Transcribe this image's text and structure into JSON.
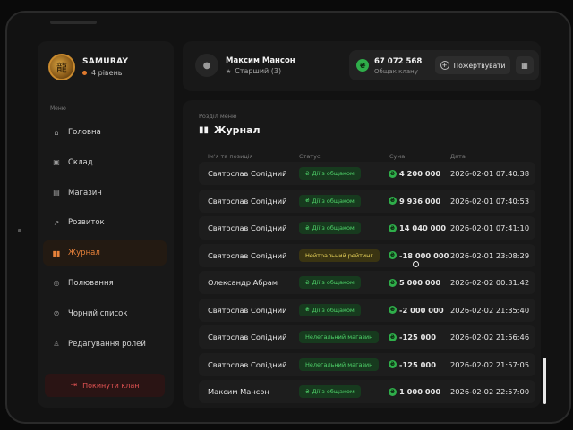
{
  "sidebar": {
    "profile": {
      "name": "SAMURAY",
      "level": "4 рівень",
      "avatar_icon": "dragon-emblem-icon"
    },
    "menu_caption": "Меню",
    "items": [
      {
        "label": "Головна",
        "icon": "home-icon"
      },
      {
        "label": "Склад",
        "icon": "box-icon"
      },
      {
        "label": "Магазин",
        "icon": "store-icon"
      },
      {
        "label": "Розвиток",
        "icon": "chart-icon"
      },
      {
        "label": "Журнал",
        "icon": "book-icon",
        "active": true
      },
      {
        "label": "Полювання",
        "icon": "target-icon"
      },
      {
        "label": "Чорний список",
        "icon": "ban-icon"
      },
      {
        "label": "Редагування ролей",
        "icon": "user-edit-icon"
      }
    ],
    "leave_button": "Покинути клан"
  },
  "header": {
    "user_name": "Максим Мансон",
    "user_rank": "Старший (3)",
    "funds_amount": "67 072 568",
    "funds_caption": "Общак клану",
    "donate_button": "Пожертвувати"
  },
  "journal": {
    "section_caption": "Розділ меню",
    "title": "Журнал",
    "columns": {
      "name": "Ім'я та позиція",
      "status": "Статус",
      "amount": "Сума",
      "date": "Дата"
    },
    "rows": [
      {
        "name": "Святослав Солідний",
        "status": "Дії з общаком",
        "status_color": "green",
        "amount": "4 200 000",
        "date": "2026-02-01 07:40:38"
      },
      {
        "name": "Святослав Солідний",
        "status": "Дії з общаком",
        "status_color": "green",
        "amount": "9 936 000",
        "date": "2026-02-01 07:40:53"
      },
      {
        "name": "Святослав Солідний",
        "status": "Дії з общаком",
        "status_color": "green",
        "amount": "14 040 000",
        "date": "2026-02-01 07:41:10"
      },
      {
        "name": "Святослав Солідний",
        "status": "Нейтральний рейтинг",
        "status_color": "yellow",
        "amount": "-18 000 000",
        "date": "2026-02-01 23:08:29"
      },
      {
        "name": "Олександр Абрам",
        "status": "Дії з общаком",
        "status_color": "green",
        "amount": "5 000 000",
        "date": "2026-02-02 00:31:42"
      },
      {
        "name": "Святослав Солідний",
        "status": "Дії з общаком",
        "status_color": "green",
        "amount": "-2 000 000",
        "date": "2026-02-02 21:35:40"
      },
      {
        "name": "Святослав Солідний",
        "status": "Нелегальний магазин",
        "status_color": "green",
        "amount": "-125 000",
        "date": "2026-02-02 21:56:46"
      },
      {
        "name": "Святослав Солідний",
        "status": "Нелегальний магазин",
        "status_color": "green",
        "amount": "-125 000",
        "date": "2026-02-02 21:57:05"
      },
      {
        "name": "Максим Мансон",
        "status": "Дії з общаком",
        "status_color": "green",
        "amount": "1 000 000",
        "date": "2026-02-02 22:57:00"
      }
    ]
  },
  "colors": {
    "accent": "#e8823a",
    "positive": "#4fd36a",
    "neutral": "#e8d35a",
    "danger": "#e05252"
  }
}
